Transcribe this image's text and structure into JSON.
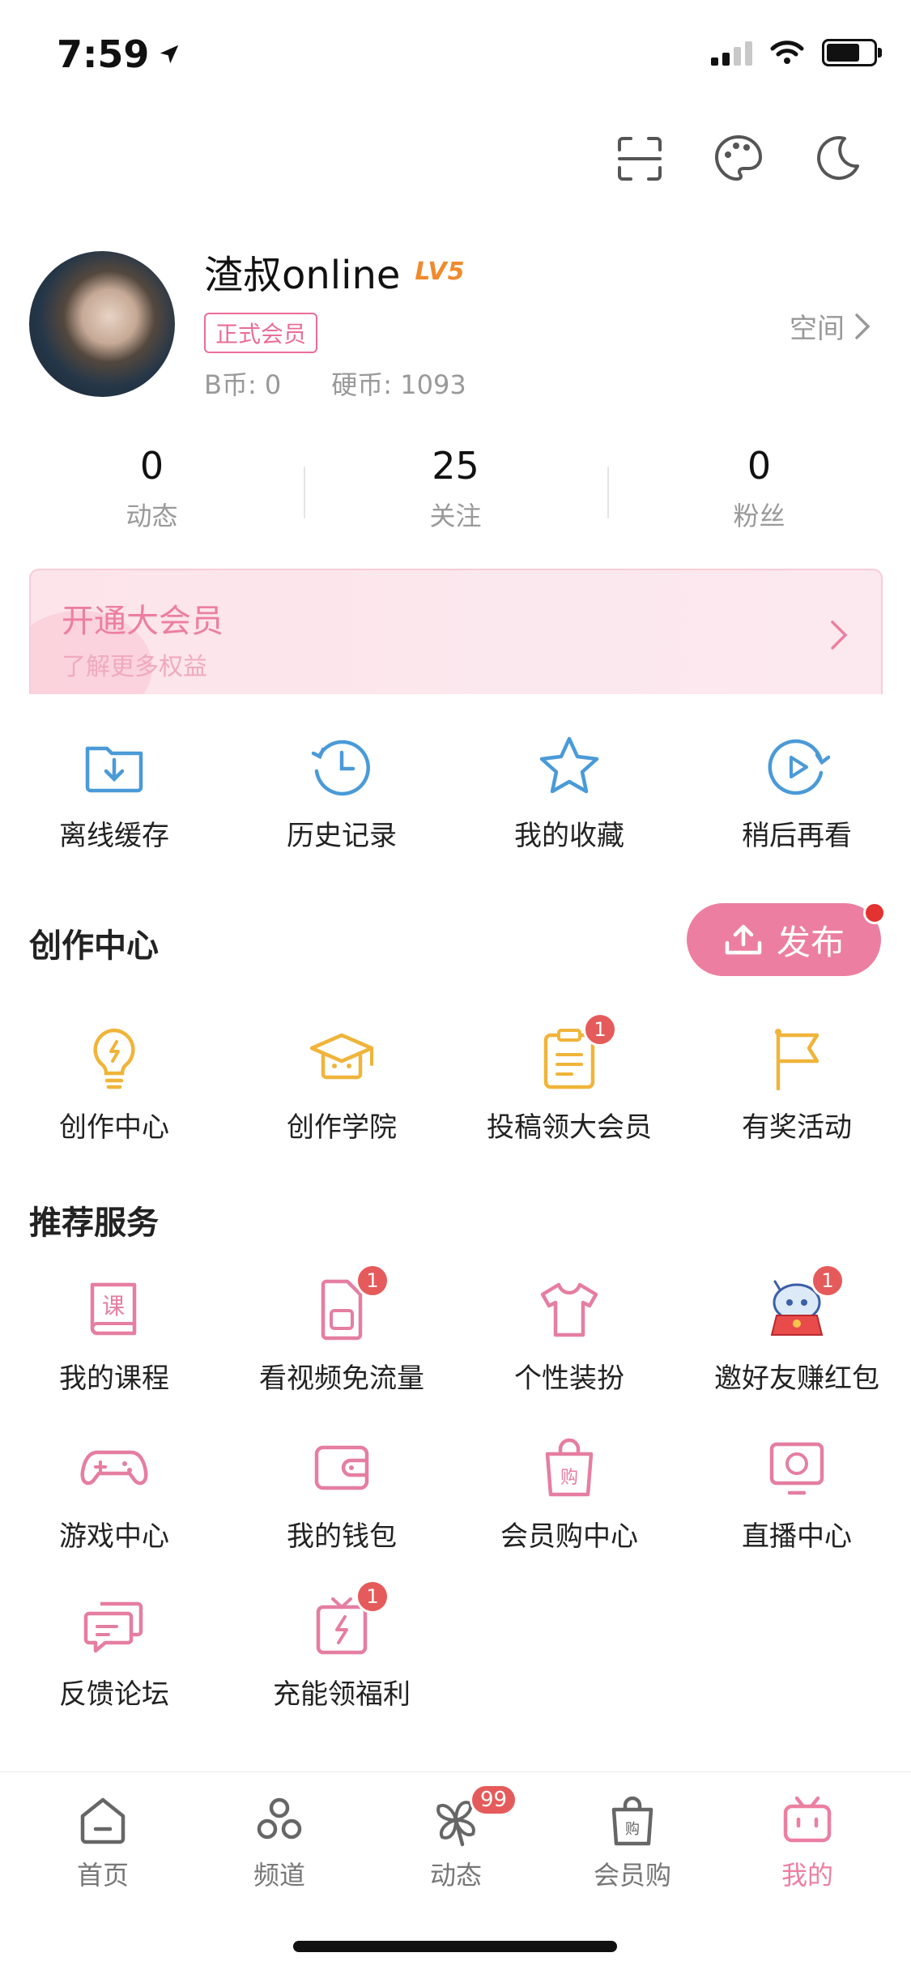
{
  "status_bar": {
    "time": "7:59"
  },
  "profile": {
    "username": "渣叔online",
    "level": "LV5",
    "vip_tag": "正式会员",
    "b_coins": "B币: 0",
    "hard_coins": "硬币: 1093",
    "space_link": "空间"
  },
  "stats": [
    {
      "value": "0",
      "label": "动态"
    },
    {
      "value": "25",
      "label": "关注"
    },
    {
      "value": "0",
      "label": "粉丝"
    }
  ],
  "vip_banner": {
    "title": "开通大会员",
    "subtitle": "了解更多权益"
  },
  "quick_actions": [
    {
      "label": "离线缓存",
      "icon": "offline-download-icon"
    },
    {
      "label": "历史记录",
      "icon": "history-icon"
    },
    {
      "label": "我的收藏",
      "icon": "star-icon"
    },
    {
      "label": "稍后再看",
      "icon": "watch-later-icon"
    }
  ],
  "creation": {
    "title": "创作中心",
    "publish_label": "发布",
    "items": [
      {
        "label": "创作中心",
        "icon": "lightbulb-icon"
      },
      {
        "label": "创作学院",
        "icon": "graduation-cap-icon"
      },
      {
        "label": "投稿领大会员",
        "icon": "clipboard-icon",
        "badge": "1"
      },
      {
        "label": "有奖活动",
        "icon": "flag-icon"
      }
    ]
  },
  "services": {
    "title": "推荐服务",
    "items": [
      {
        "label": "我的课程",
        "icon": "course-book-icon"
      },
      {
        "label": "看视频免流量",
        "icon": "sim-card-icon",
        "badge": "1"
      },
      {
        "label": "个性装扮",
        "icon": "tshirt-icon"
      },
      {
        "label": "邀好友赚红包",
        "icon": "mascot-red-packet-icon",
        "badge": "1"
      },
      {
        "label": "游戏中心",
        "icon": "gamepad-icon"
      },
      {
        "label": "我的钱包",
        "icon": "wallet-icon"
      },
      {
        "label": "会员购中心",
        "icon": "shopping-bag-icon"
      },
      {
        "label": "直播中心",
        "icon": "tv-icon"
      },
      {
        "label": "反馈论坛",
        "icon": "chat-bubbles-icon"
      },
      {
        "label": "充能领福利",
        "icon": "gift-energy-icon",
        "badge": "1"
      }
    ]
  },
  "tabbar": [
    {
      "label": "首页",
      "icon": "home-icon"
    },
    {
      "label": "频道",
      "icon": "channels-icon"
    },
    {
      "label": "动态",
      "icon": "pinwheel-icon",
      "badge": "99"
    },
    {
      "label": "会员购",
      "icon": "shopping-bag-icon"
    },
    {
      "label": "我的",
      "icon": "bilibili-tv-icon",
      "active": true
    }
  ],
  "colors": {
    "accent_pink": "#ec7fa1",
    "badge_red": "#e55b5b",
    "icon_blue": "#4a9ad8",
    "icon_yellow": "#f0b43a"
  }
}
